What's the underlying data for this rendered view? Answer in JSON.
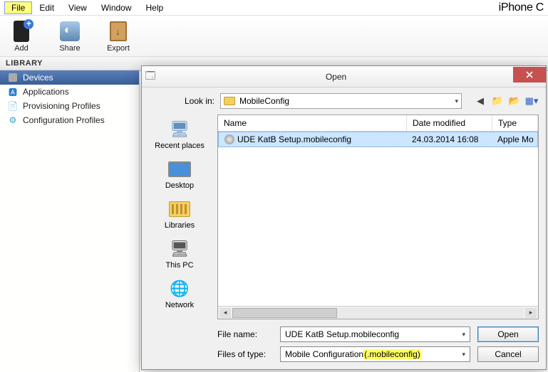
{
  "menubar": {
    "file": "File",
    "edit": "Edit",
    "view": "View",
    "window": "Window",
    "help": "Help"
  },
  "appname": "iPhone C",
  "toolbar": {
    "add": "Add",
    "share": "Share",
    "export": "Export"
  },
  "library": {
    "header": "LIBRARY",
    "items": {
      "devices": "Devices",
      "applications": "Applications",
      "provisioning": "Provisioning Profiles",
      "configuration": "Configuration Profiles"
    }
  },
  "dialog": {
    "title": "Open",
    "lookin_label": "Look in:",
    "lookin_value": "MobileConfig",
    "places": {
      "recent": "Recent places",
      "desktop": "Desktop",
      "libraries": "Libraries",
      "thispc": "This PC",
      "network": "Network"
    },
    "columns": {
      "name": "Name",
      "date": "Date modified",
      "type": "Type"
    },
    "rows": [
      {
        "name": "UDE KatB  Setup.mobileconfig",
        "date": "24.03.2014 16:08",
        "type": "Apple Mo"
      }
    ],
    "filename_label": "File name:",
    "filename_value": "UDE KatB  Setup.mobileconfig",
    "filetype_label": "Files of type:",
    "filetype_prefix": "Mobile Configuration ",
    "filetype_hilite": "(.mobileconfig)",
    "open_btn": "Open",
    "cancel_btn": "Cancel"
  }
}
